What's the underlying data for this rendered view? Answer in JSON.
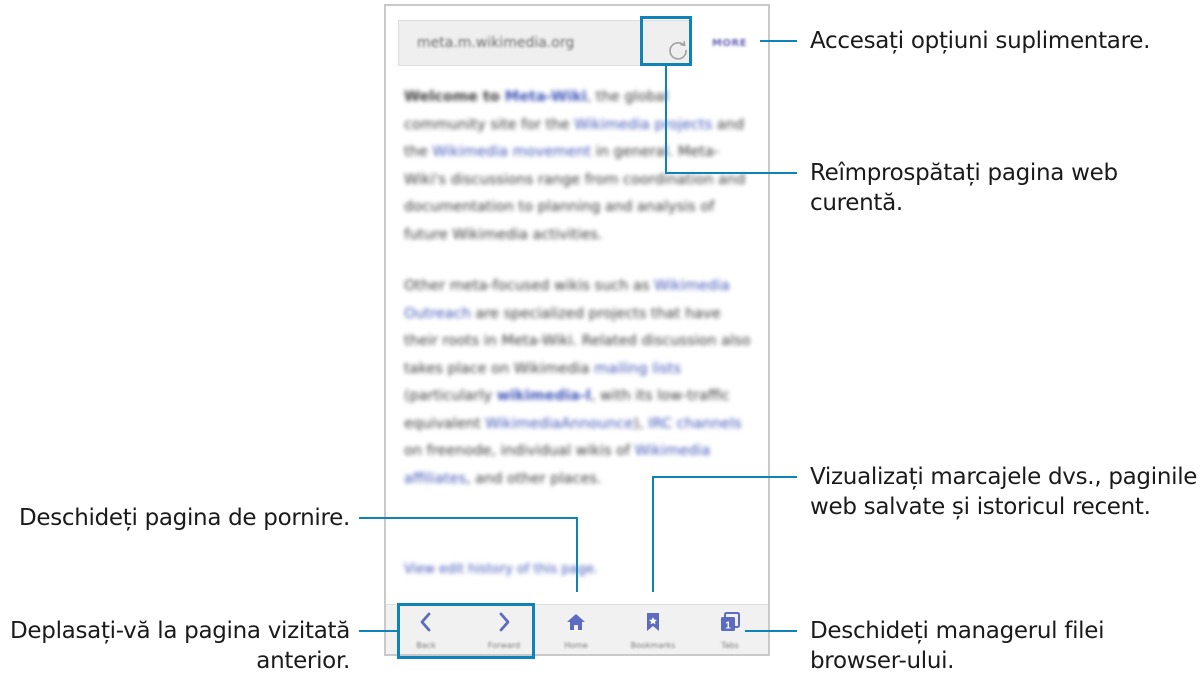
{
  "browser": {
    "url": "meta.m.wikimedia.org",
    "more_label": "MORE",
    "refresh_icon": "refresh-icon",
    "content": {
      "p1_intro": "Welcome to ",
      "p1_link1": "Meta-Wiki",
      "p1_text1": ", the global community site for the ",
      "p1_link2": "Wikimedia projects",
      "p1_text2": " and the ",
      "p1_link3": "Wikimedia movement",
      "p1_text3": " in general. Meta-Wiki's discussions range from coordination and documentation to planning and analysis of future Wikimedia activities.",
      "p2_text1": "Other meta-focused wikis such as ",
      "p2_link1": "Wikimedia Outreach",
      "p2_text2": " are specialized projects that have their roots in Meta-Wiki. Related discussion also takes place on Wikimedia ",
      "p2_link2": "mailing lists",
      "p2_text3": " (particularly ",
      "p2_link3": "wikimedia-l",
      "p2_text4": ", with its low-traffic equivalent ",
      "p2_link4": "WikimediaAnnounce",
      "p2_text5": "), ",
      "p2_link5": "IRC channels",
      "p2_text6": " on freenode, individual wikis of ",
      "p2_link6": "Wikimedia affiliates",
      "p2_text7": ", and other places.",
      "history_link": "View edit history of this page."
    },
    "nav": {
      "back": "Back",
      "forward": "Forward",
      "home": "Home",
      "bookmarks": "Bookmarks",
      "tabs": "Tabs",
      "tabs_count": "1"
    }
  },
  "callouts": {
    "more": "Accesați opțiuni suplimentare.",
    "refresh_line1": "Reîmprospătați pagina web",
    "refresh_line2": "curentă.",
    "bookmarks_line1": "Vizualizați marcajele dvs., paginile",
    "bookmarks_line2": "web salvate și istoricul recent.",
    "home": "Deschideți pagina de pornire.",
    "back_line1": "Deplasați-vă la pagina vizitată",
    "back_line2": "anterior.",
    "tabs_line1": "Deschideți managerul filei",
    "tabs_line2": "browser-ului."
  },
  "colors": {
    "accent": "#0f83b8",
    "link": "#3f55b8",
    "icon": "#5c6bc0"
  }
}
